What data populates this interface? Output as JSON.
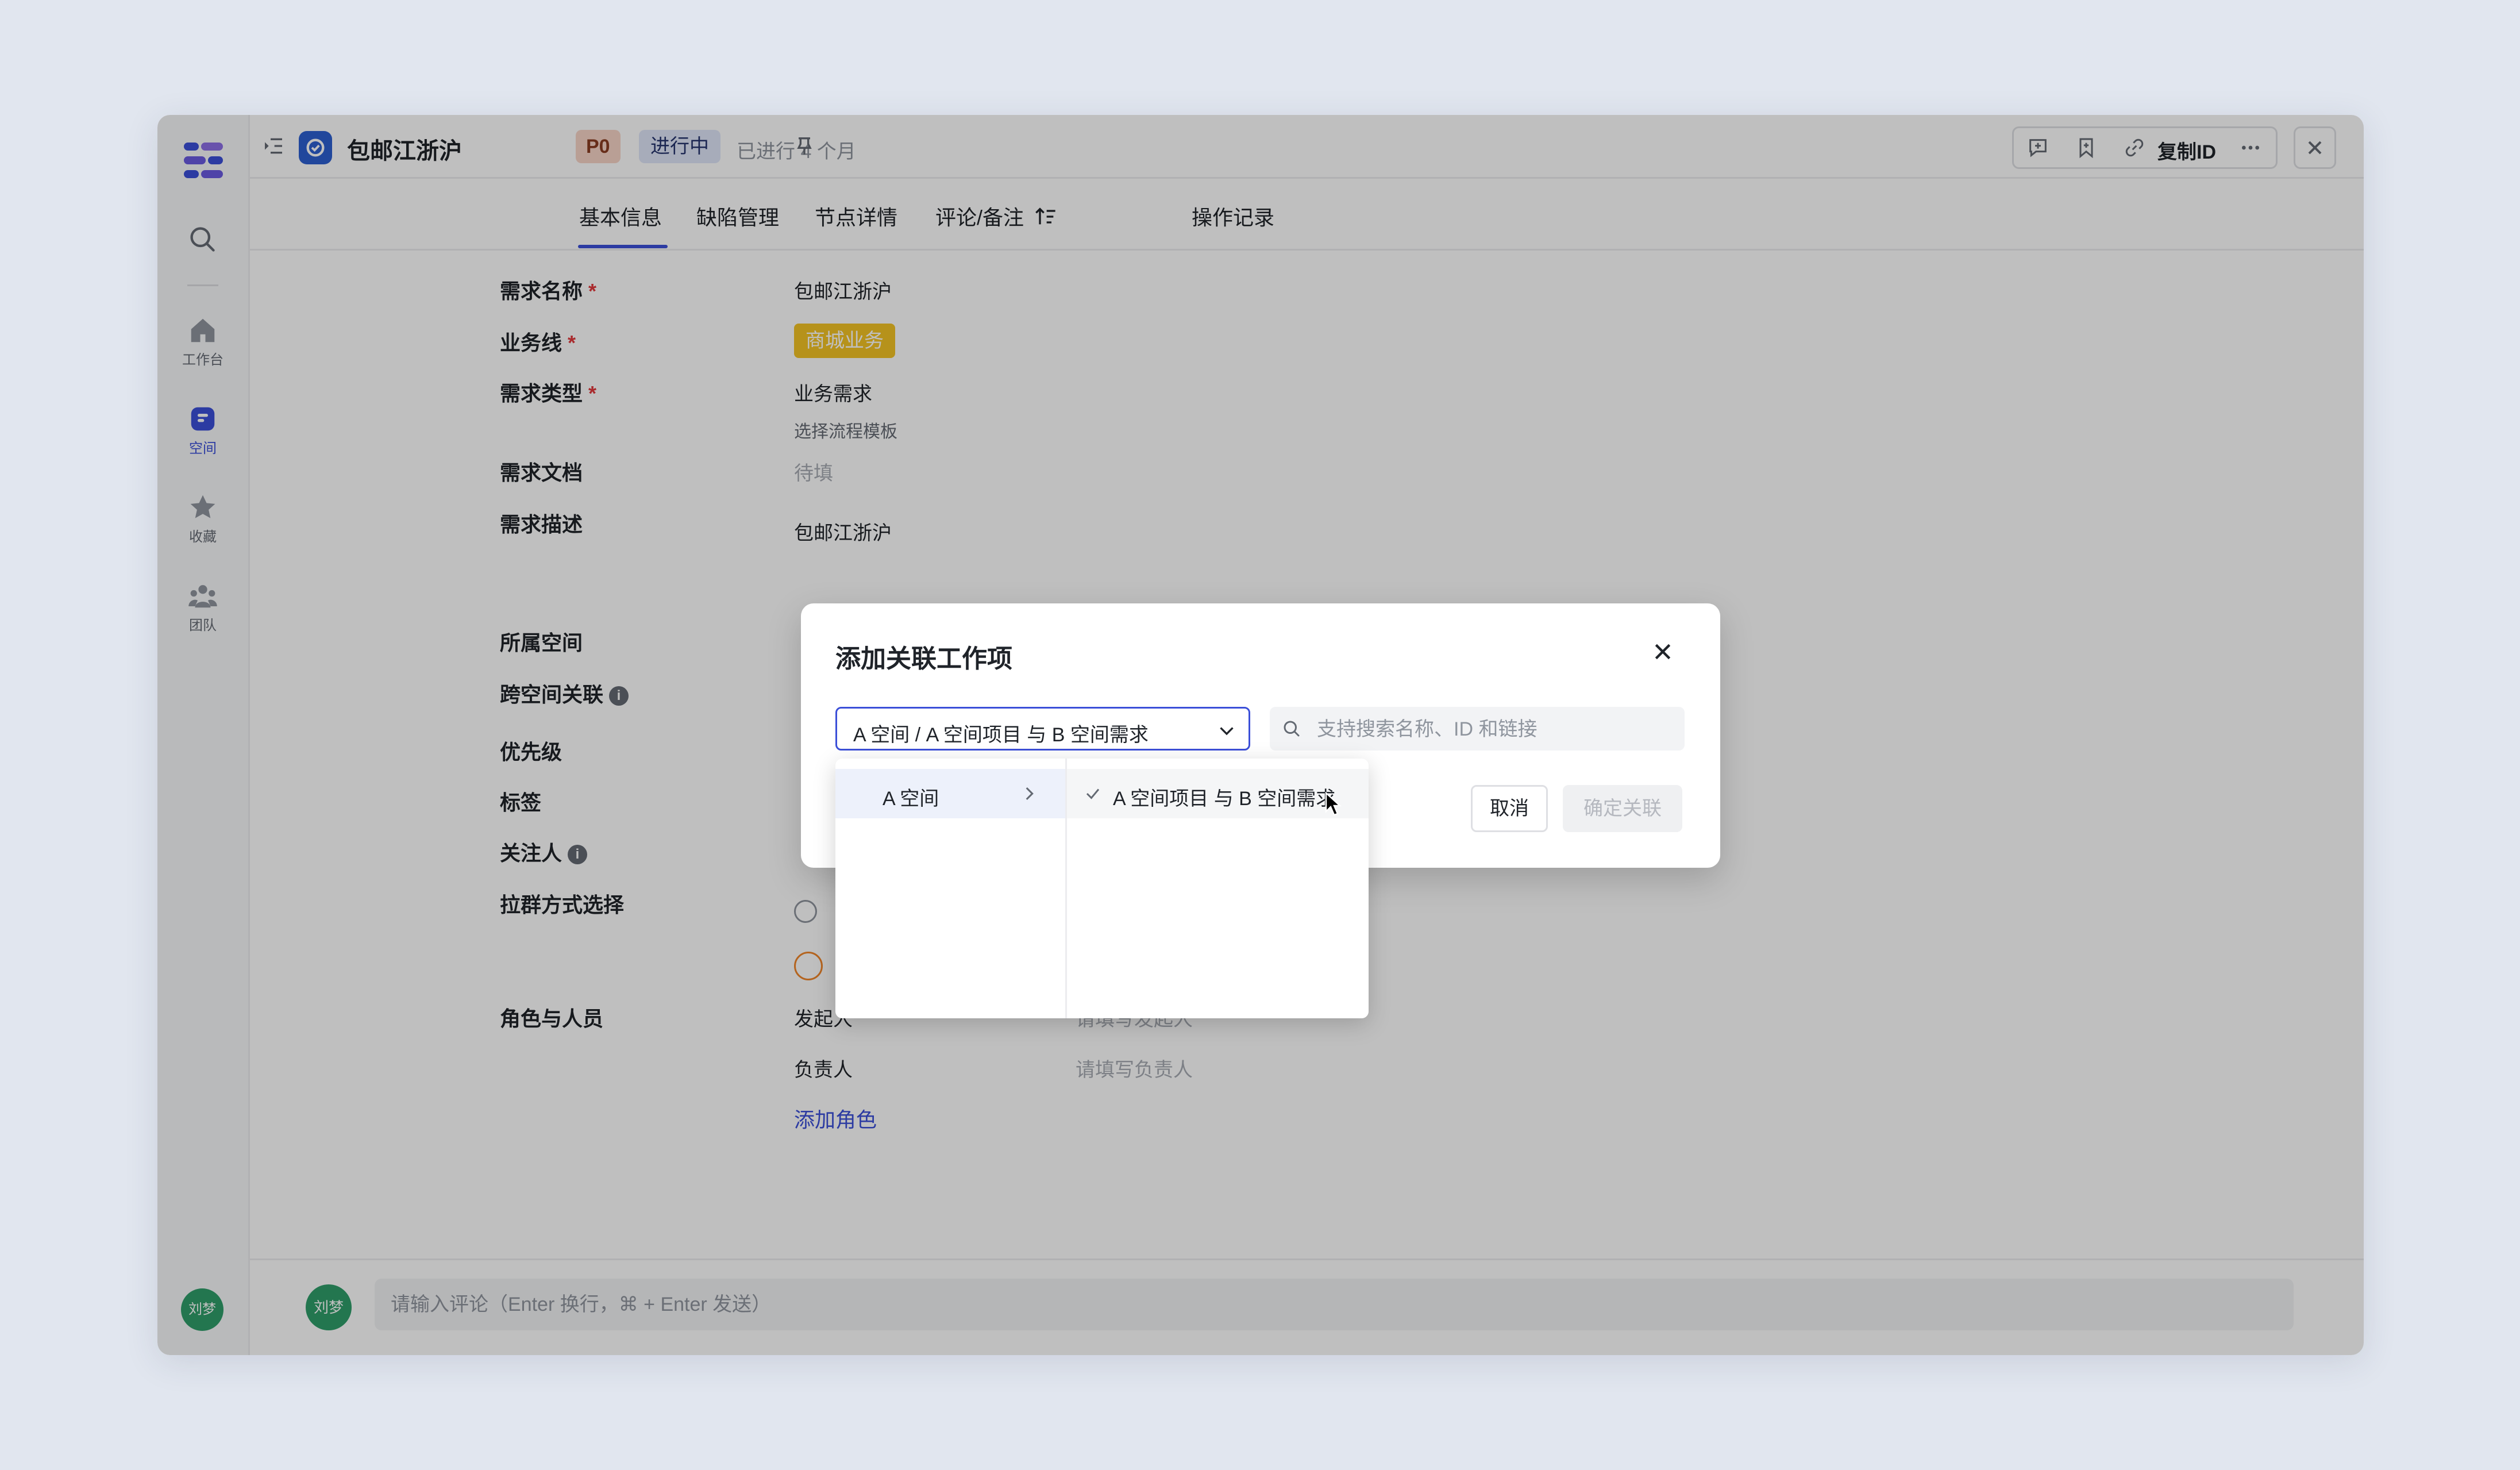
{
  "header": {
    "title": "包邮江浙沪",
    "priority": "P0",
    "status": "进行中",
    "elapsed": "已进行 4 个月",
    "copy_id": "复制ID"
  },
  "nav": {
    "items": [
      {
        "label": "工作台"
      },
      {
        "label": "空间"
      },
      {
        "label": "收藏"
      },
      {
        "label": "团队"
      }
    ],
    "user_avatar": "刘梦"
  },
  "tabs": [
    {
      "label": "基本信息"
    },
    {
      "label": "缺陷管理"
    },
    {
      "label": "节点详情"
    },
    {
      "label": "评论/备注"
    },
    {
      "label": "操作记录"
    }
  ],
  "form": {
    "name_label": "需求名称",
    "name_value": "包邮江浙沪",
    "biz_label": "业务线",
    "biz_value": "商城业务",
    "type_label": "需求类型",
    "type_value": "业务需求",
    "type_sub": "选择流程模板",
    "doc_label": "需求文档",
    "doc_value": "待填",
    "desc_label": "需求描述",
    "desc_value": "包邮江浙沪",
    "space_label": "所属空间",
    "cross_label": "跨空间关联",
    "priority_label": "优先级",
    "tags_label": "标签",
    "followers_label": "关注人",
    "group_label": "拉群方式选择",
    "roles_label": "角色与人员",
    "initiator_label": "发起人",
    "initiator_placeholder": "请填写发起人",
    "owner_label": "负责人",
    "owner_placeholder": "请填写负责人",
    "add_role": "添加角色",
    "required_mark": "*"
  },
  "comment": {
    "avatar": "刘梦",
    "placeholder": "请输入评论（Enter 换行，⌘ + Enter 发送）"
  },
  "modal": {
    "title": "添加关联工作项",
    "select_value": "A 空间 / A 空间项目 与 B 空间需求",
    "search_placeholder": "支持搜索名称、ID 和链接",
    "cancel": "取消",
    "confirm": "确定关联",
    "dropdown": {
      "level1": "A 空间",
      "level2": "A 空间项目 与 B 空间需求"
    }
  },
  "colors": {
    "accent": "#3b4fd8",
    "biz_tag": "#f3c324",
    "p0_bg": "#f7d4c7",
    "status_bg": "#dfe6f8",
    "avatar": "#2f9e6a"
  }
}
